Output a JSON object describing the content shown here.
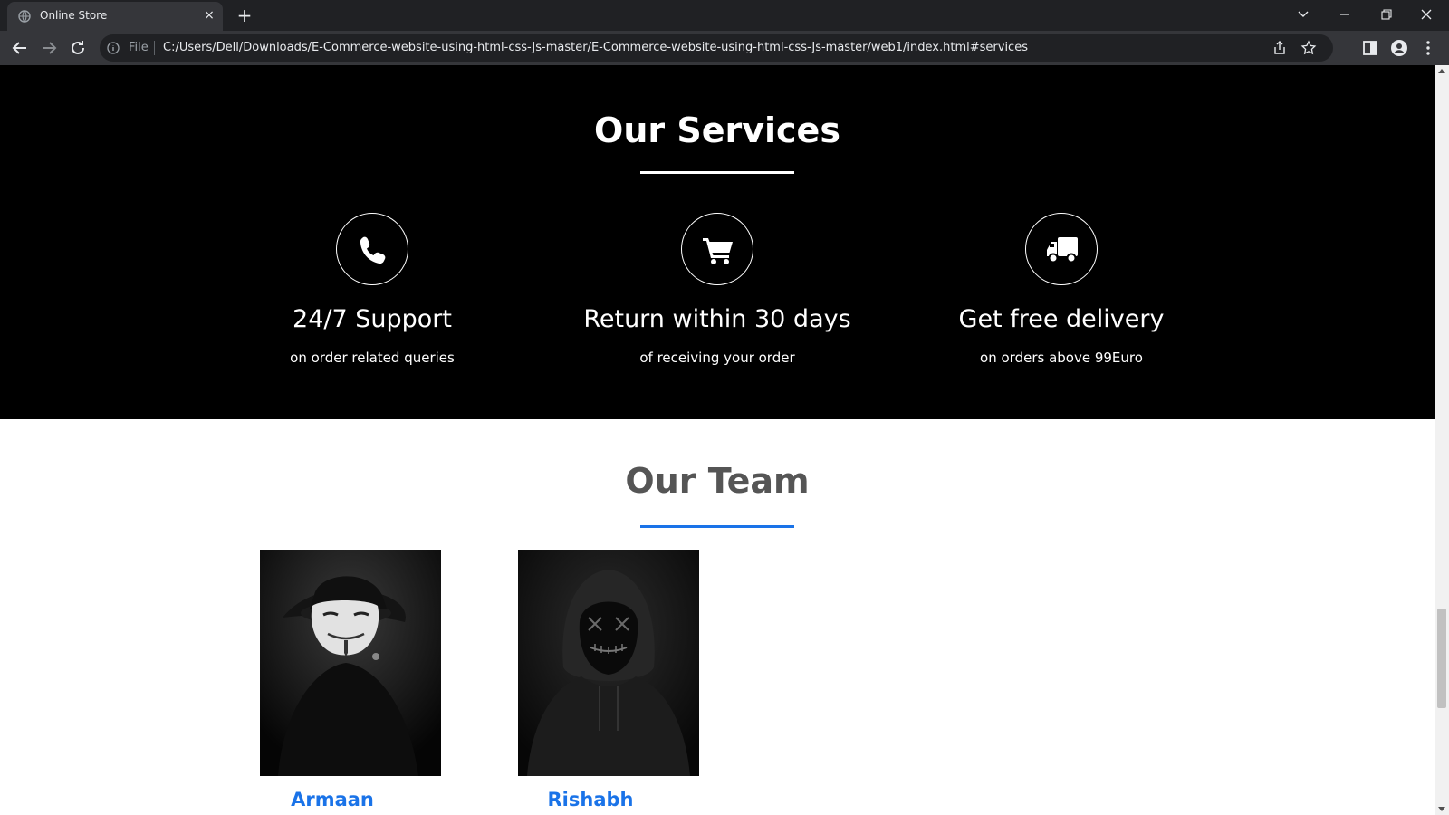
{
  "browser": {
    "tab_title": "Online Store",
    "tab_close": "×",
    "new_tab": "+",
    "file_label": "File",
    "url": "C:/Users/Dell/Downloads/E-Commerce-website-using-html-css-Js-master/E-Commerce-website-using-html-css-Js-master/web1/index.html#services"
  },
  "services": {
    "title": "Our Services",
    "items": [
      {
        "title": "24/7 Support",
        "subtitle": "on order related queries",
        "icon": "phone-icon"
      },
      {
        "title": "Return within 30 days",
        "subtitle": "of receiving your order",
        "icon": "cart-icon"
      },
      {
        "title": "Get free delivery",
        "subtitle": "on orders above 99Euro",
        "icon": "truck-icon"
      }
    ]
  },
  "team": {
    "title": "Our Team",
    "members": [
      {
        "name": "Armaan"
      },
      {
        "name": "Rishabh"
      }
    ]
  },
  "colors": {
    "accent": "#1a73e8",
    "chrome_dark": "#202124",
    "chrome_tab": "#35363a"
  }
}
